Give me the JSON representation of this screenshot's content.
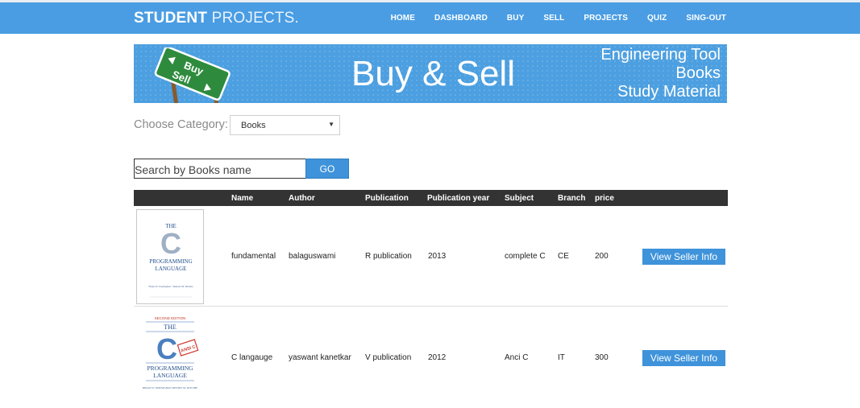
{
  "brand": {
    "bold": "STUDENT",
    "light": " PROJECTS."
  },
  "nav": [
    "HOME",
    "DASHBOARD",
    "BUY",
    "SELL",
    "PROJECTS",
    "QUIZ",
    "SING-OUT"
  ],
  "banner": {
    "title": "Buy & Sell",
    "lines": [
      "Engineering Tool",
      "Books",
      "Study Material"
    ],
    "sign_top": "Buy",
    "sign_bottom": "Sell"
  },
  "category": {
    "label": "Choose Category:",
    "selected": "Books"
  },
  "search": {
    "placeholder": "Search by Books name",
    "button": "GO"
  },
  "table": {
    "headers": [
      "Name",
      "Author",
      "Publication",
      "Publication year",
      "Subject",
      "Branch",
      "price"
    ],
    "rows": [
      {
        "name": "fundamental",
        "author": "balaguswami",
        "publication": "R publication",
        "year": "2013",
        "subject": "complete C",
        "branch": "CE",
        "price": "200",
        "button": "View Seller Info",
        "cover": {
          "l1": "THE",
          "big": "C",
          "l2": "PROGRAMMING",
          "l3": "LANGUAGE",
          "authors": "Brian W. Kernighan • Dennis M. Ritchie"
        }
      },
      {
        "name": "C langauge",
        "author": "yaswant kanetkar",
        "publication": "V publication",
        "year": "2012",
        "subject": "Anci C",
        "branch": "IT",
        "price": "300",
        "button": "View Seller Info",
        "cover": {
          "edition": "SECOND EDITION",
          "l1": "THE",
          "big": "C",
          "badge": "ANSI C",
          "l2": "PROGRAMMING",
          "l3": "LANGUAGE",
          "authors": "BRIAN W. KERNIGHAN DENNIS M. RITCHIE"
        }
      }
    ]
  },
  "colors": {
    "primary": "#4a9de3",
    "button": "#3f93da",
    "header_dark": "#333333"
  }
}
